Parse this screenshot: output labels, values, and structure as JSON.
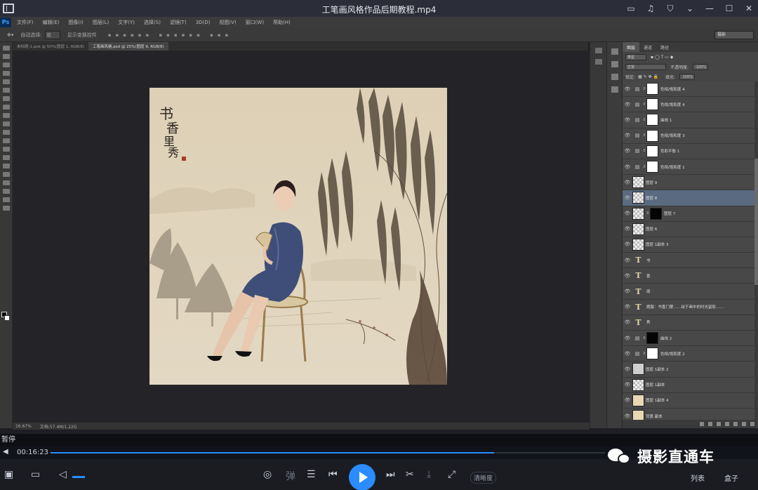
{
  "player": {
    "title": "工笔画风格作品后期教程.mp4",
    "status": "暂停",
    "current_time": "00:16:23",
    "progress": 0.8,
    "controls": {
      "clear_label": "清晰度",
      "list_label": "列表",
      "box_label": "盒子"
    }
  },
  "photoshop": {
    "logo": "Ps",
    "menu": [
      "文件(F)",
      "编辑(E)",
      "图像(I)",
      "图层(L)",
      "文字(Y)",
      "选择(S)",
      "滤镜(T)",
      "3D(D)",
      "视图(V)",
      "窗口(W)",
      "帮助(H)"
    ],
    "options": {
      "auto_select": "自动选择:",
      "auto_select_value": "组",
      "show_transform": "显示变换控件",
      "workspace": "摄影"
    },
    "tabs": [
      "未标题-1.psd @ 50%(图层 1, RGB/8)",
      "工笔画风格.psd @ 25%(图层 9, RGB/8)"
    ],
    "status_zoom": "16.67%",
    "status_doc": "文档:57.4M/1.22G",
    "layers_panel": {
      "tabs": [
        "图层",
        "通道",
        "路径"
      ],
      "filter_label": "类型",
      "blend_mode": "正常",
      "opacity_label": "不透明度:",
      "opacity": "100%",
      "lock_label": "锁定:",
      "fill_label": "填充:",
      "fill": "100%",
      "layers": [
        {
          "name": "色相/饱和度 4",
          "type": "adjustment"
        },
        {
          "name": "色相/饱和度 4",
          "type": "adjustment"
        },
        {
          "name": "曲线 1",
          "type": "adjustment"
        },
        {
          "name": "色相/饱和度 3",
          "type": "adjustment"
        },
        {
          "name": "色彩平衡 1",
          "type": "adjustment"
        },
        {
          "name": "色相/饱和度 1",
          "type": "adjustment"
        },
        {
          "name": "图层 9",
          "type": "image"
        },
        {
          "name": "图层 8",
          "type": "check",
          "selected": true
        },
        {
          "name": "图层 7",
          "type": "image-mask"
        },
        {
          "name": "图层 6",
          "type": "check"
        },
        {
          "name": "图层 1副本 3",
          "type": "check"
        },
        {
          "name": "书",
          "type": "text"
        },
        {
          "name": "香",
          "type": "text"
        },
        {
          "name": "闺",
          "type": "text"
        },
        {
          "name": "题跋：书香门第……绘于画中的时光留影……",
          "type": "text"
        },
        {
          "name": "秀",
          "type": "text"
        },
        {
          "name": "曲线 2",
          "type": "adjustment-dark"
        },
        {
          "name": "色相/饱和度 2",
          "type": "adjustment"
        },
        {
          "name": "图层 1副本 2",
          "type": "gray"
        },
        {
          "name": "图层 1副本",
          "type": "check"
        },
        {
          "name": "图层 1副本 4",
          "type": "beige"
        },
        {
          "name": "背景 副本",
          "type": "beige"
        }
      ]
    }
  },
  "watermark": {
    "text": "摄影直通车"
  }
}
